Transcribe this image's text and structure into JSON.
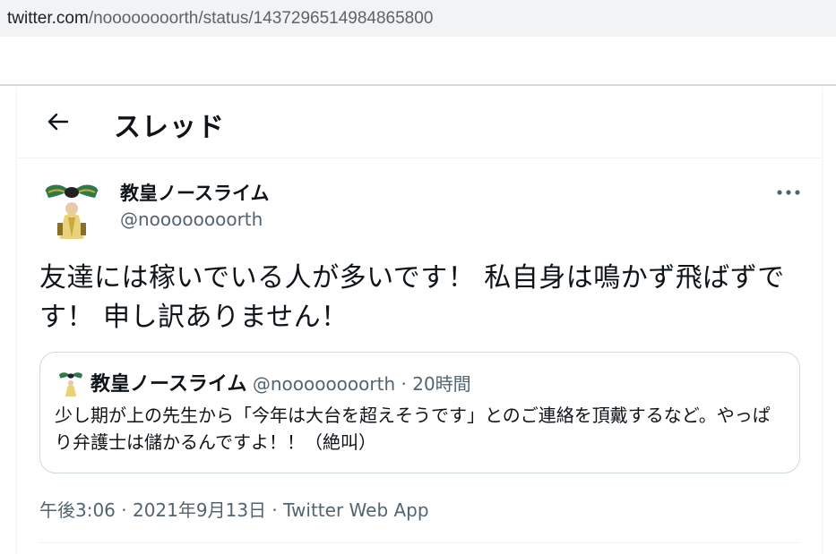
{
  "browser": {
    "url_host": "twitter.com",
    "url_path": "/noooooooorth/status/1437296514984865800"
  },
  "thread": {
    "title": "スレッド",
    "back_icon": "arrow-left-icon"
  },
  "tweet": {
    "author_name": "教皇ノースライム",
    "author_handle": "@noooooooorth",
    "more_icon": "more-horizontal-icon",
    "text": "友達には稼いでいる人が多いです！ 私自身は鳴かず飛ばずです！ 申し訳ありません！",
    "timestamp": "午後3:06 · 2021年9月13日",
    "separator": " · ",
    "source": "Twitter Web App"
  },
  "quote": {
    "author_name": "教皇ノースライム",
    "author_handle": "@noooooooorth",
    "separator": " · ",
    "time_ago": "20時間",
    "text": "少し期が上の先生から「今年は大台を超えそうです」とのご連絡を頂戴するなど。やっぱり弁護士は儲かるんですよ！！（絶叫）"
  },
  "colors": {
    "text_primary": "#0f1419",
    "text_secondary": "#536471",
    "border": "#cfd9de"
  }
}
